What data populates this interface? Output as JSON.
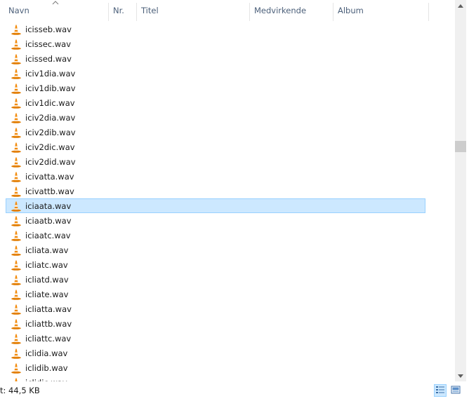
{
  "columns": [
    {
      "label": "Navn"
    },
    {
      "label": "Nr."
    },
    {
      "label": "Titel"
    },
    {
      "label": "Medvirkende"
    },
    {
      "label": "Album"
    }
  ],
  "files": [
    {
      "name": "icisseb.wav"
    },
    {
      "name": "icissec.wav"
    },
    {
      "name": "icissed.wav"
    },
    {
      "name": "iciv1dia.wav"
    },
    {
      "name": "iciv1dib.wav"
    },
    {
      "name": "iciv1dic.wav"
    },
    {
      "name": "iciv2dia.wav"
    },
    {
      "name": "iciv2dib.wav"
    },
    {
      "name": "iciv2dic.wav"
    },
    {
      "name": "iciv2did.wav"
    },
    {
      "name": "icivatta.wav"
    },
    {
      "name": "icivattb.wav"
    },
    {
      "name": "iciaata.wav",
      "selected": true
    },
    {
      "name": "iciaatb.wav"
    },
    {
      "name": "iciaatc.wav"
    },
    {
      "name": "icliata.wav"
    },
    {
      "name": "icliatc.wav"
    },
    {
      "name": "icliatd.wav"
    },
    {
      "name": "icliate.wav"
    },
    {
      "name": "icliatta.wav"
    },
    {
      "name": "icliattb.wav"
    },
    {
      "name": "icliattc.wav"
    },
    {
      "name": "iclidia.wav"
    },
    {
      "name": "iclidib.wav"
    },
    {
      "name": "iclidic.wav"
    }
  ],
  "status": {
    "text": "t: 44,5 KB"
  },
  "icons": {
    "file": "vlc-cone-icon",
    "sort": "sort-ascending-icon",
    "details_view": "details-view-icon",
    "large_icons_view": "large-icons-view-icon"
  },
  "colors": {
    "selection_bg": "#cce8ff",
    "selection_border": "#99d1ff",
    "header_text": "#4c607a",
    "cone_orange": "#f28c0f"
  }
}
